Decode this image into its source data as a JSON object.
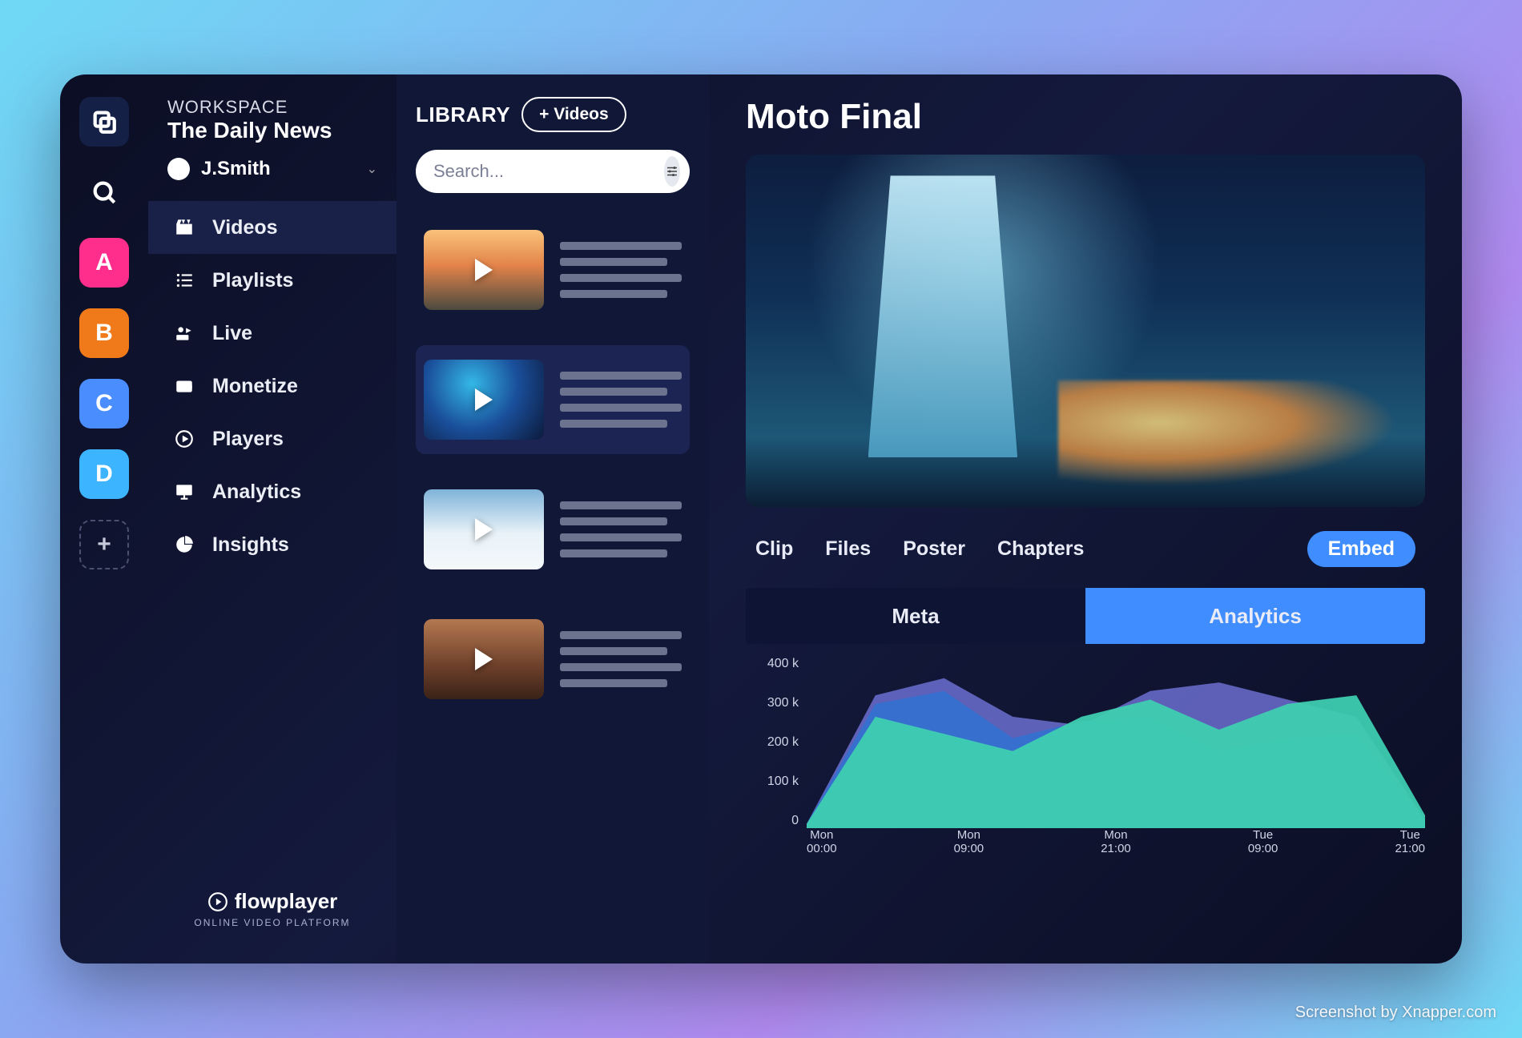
{
  "workspace": {
    "label": "WORKSPACE",
    "name": "The Daily News"
  },
  "user": {
    "name": "J.Smith"
  },
  "rail": {
    "item_a": "A",
    "item_b": "B",
    "item_c": "C",
    "item_d": "D",
    "colors": {
      "a": "#ff2d8b",
      "b": "#f07a1a",
      "c": "#4a8dff",
      "d": "#3db4ff"
    }
  },
  "nav": {
    "videos": {
      "label": "Videos"
    },
    "playlists": {
      "label": "Playlists"
    },
    "live": {
      "label": "Live"
    },
    "monetize": {
      "label": "Monetize"
    },
    "players": {
      "label": "Players"
    },
    "analytics": {
      "label": "Analytics"
    },
    "insights": {
      "label": "Insights"
    }
  },
  "brand": {
    "name": "flowplayer",
    "tagline": "ONLINE VIDEO PLATFORM"
  },
  "library": {
    "title": "LIBRARY",
    "add_button": "+ Videos",
    "search_placeholder": "Search..."
  },
  "detail": {
    "title": "Moto Final",
    "tabs": {
      "clip": "Clip",
      "files": "Files",
      "poster": "Poster",
      "chapters": "Chapters",
      "embed": "Embed"
    },
    "sub_tabs": {
      "meta": "Meta",
      "analytics": "Analytics"
    }
  },
  "chart_data": {
    "type": "area",
    "ylabel": "",
    "ylim": [
      0,
      400000
    ],
    "y_ticks": [
      "400 k",
      "300 k",
      "200 k",
      "100 k",
      "0"
    ],
    "x": [
      "Mon 00:00",
      "Mon 09:00",
      "Mon 21:00",
      "Tue 09:00",
      "Tue 21:00"
    ],
    "x_ticks": [
      {
        "top": "Mon",
        "bottom": "00:00"
      },
      {
        "top": "Mon",
        "bottom": "09:00"
      },
      {
        "top": "Mon",
        "bottom": "21:00"
      },
      {
        "top": "Tue",
        "bottom": "09:00"
      },
      {
        "top": "Tue",
        "bottom": "21:00"
      }
    ],
    "series": [
      {
        "name": "teal",
        "color": "#3eceb0",
        "values": [
          10000,
          260000,
          220000,
          180000,
          260000,
          300000,
          230000,
          290000,
          310000,
          30000
        ]
      },
      {
        "name": "blue",
        "color": "#2f72d1",
        "values": [
          10000,
          290000,
          320000,
          210000,
          250000,
          260000,
          180000,
          210000,
          220000,
          20000
        ]
      },
      {
        "name": "purple",
        "color": "#6c6fd0",
        "values": [
          10000,
          310000,
          350000,
          260000,
          240000,
          320000,
          340000,
          300000,
          260000,
          20000
        ]
      }
    ]
  },
  "credit": "Screenshot by Xnapper.com"
}
